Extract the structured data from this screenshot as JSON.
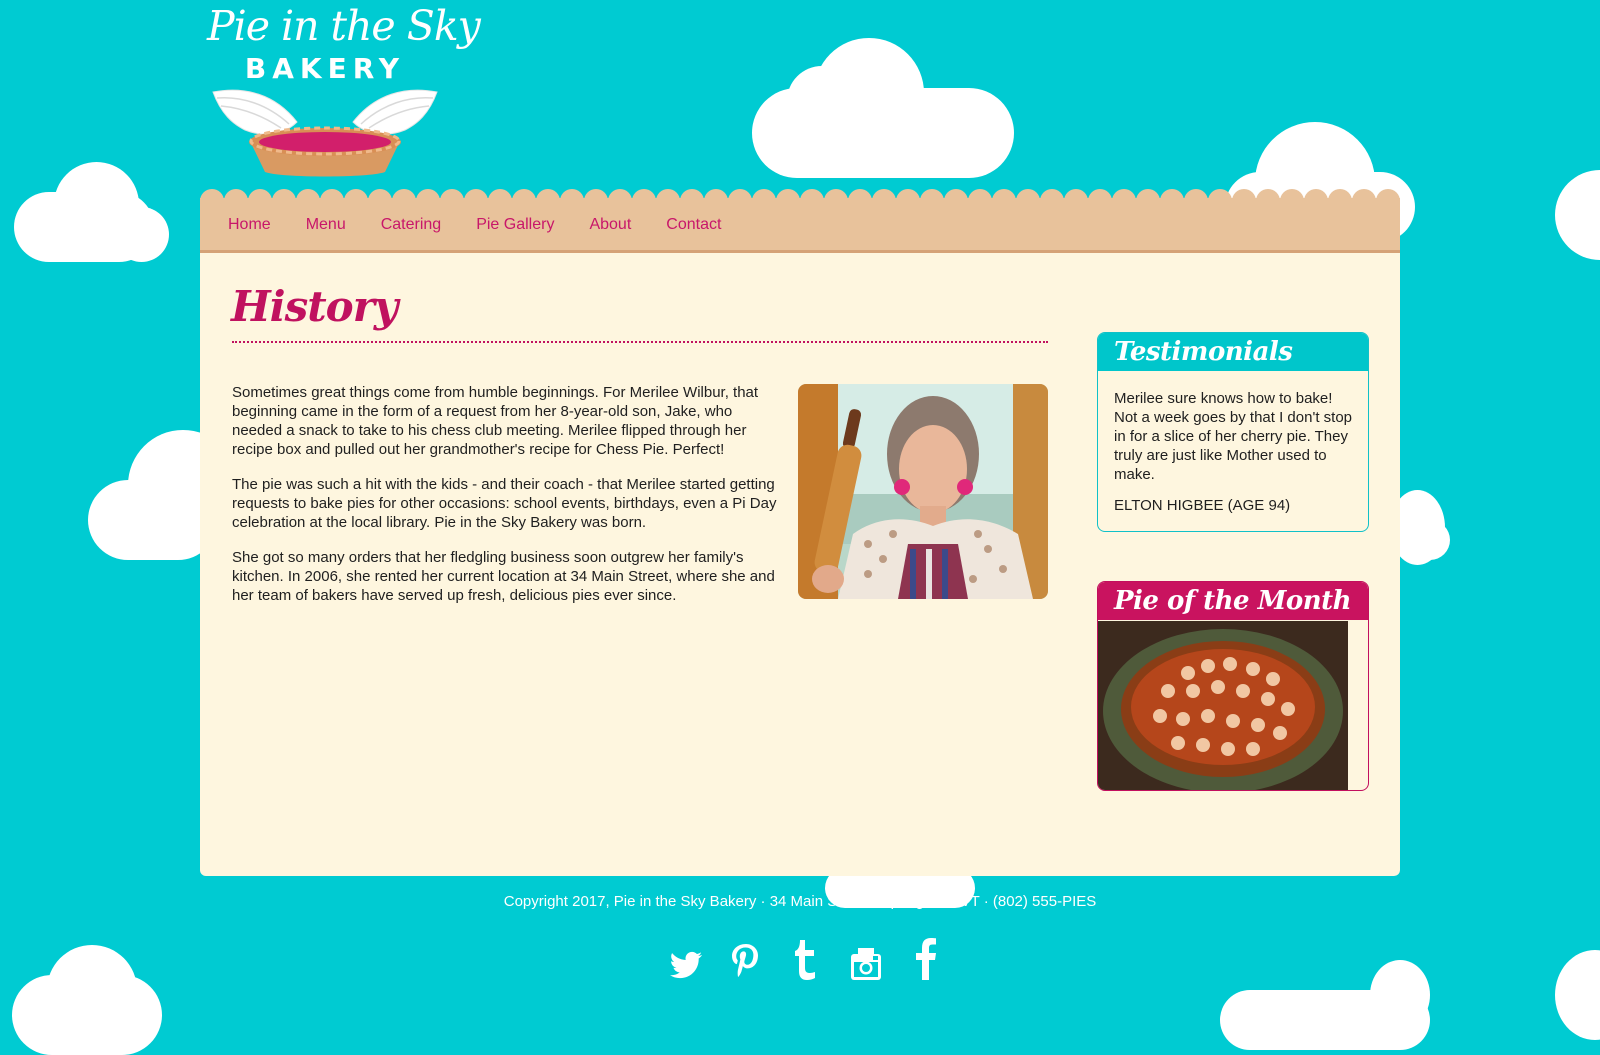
{
  "logo": {
    "script_text": "Pie in the Sky",
    "subtitle": "BAKERY"
  },
  "nav": {
    "items": [
      {
        "label": "Home"
      },
      {
        "label": "Menu"
      },
      {
        "label": "Catering"
      },
      {
        "label": "Pie Gallery"
      },
      {
        "label": "About"
      },
      {
        "label": "Contact"
      }
    ]
  },
  "main": {
    "title": "History",
    "paragraphs": [
      "Sometimes great things come from humble beginnings. For Merilee Wilbur, that beginning came in the form of a request from her 8-year-old son, Jake, who needed a snack to take to his chess club meeting. Merilee flipped through her recipe box and pulled out her grandmother's recipe for Chess Pie. Perfect!",
      "The pie was such a hit with the kids - and their coach - that Merilee started getting requests to bake pies for other occasions: school events, birthdays, even a Pi Day celebration at the local library. Pie in the Sky Bakery was born.",
      "She got so many orders that her fledgling business soon outgrew her family's kitchen. In 2006, she rented her current location at 34 Main Street, where she and her team of bakers have served up fresh, delicious pies ever since."
    ]
  },
  "sidebar": {
    "testimonials": {
      "title": "Testimonials",
      "quote": "Merilee sure knows how to bake! Not a week goes by that I don't stop in for a slice of her cherry pie. They truly are just like Mother used to make.",
      "author": "ELTON HIGBEE (AGE 94)"
    },
    "pie_of_month": {
      "title": "Pie of the Month"
    }
  },
  "footer": {
    "copyright": "Copyright 2017, Pie in the Sky Bakery · 34 Main Street · Springdale, VT · (802) 555-PIES"
  },
  "social": [
    "twitter-icon",
    "pinterest-icon",
    "tumblr-icon",
    "instagram-icon",
    "facebook-icon"
  ],
  "colors": {
    "sky": "#00cbd2",
    "cream": "#fef6df",
    "crust": "#e8c29b",
    "accent": "#c8176a",
    "teal": "#00c6cb"
  }
}
